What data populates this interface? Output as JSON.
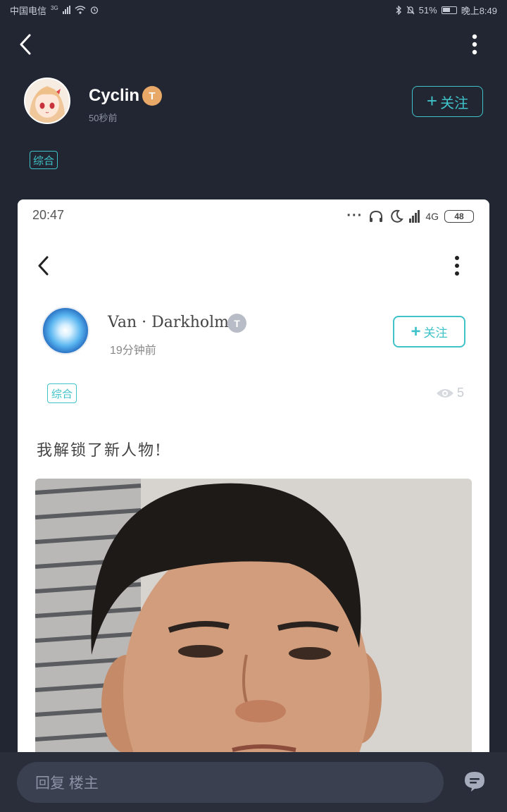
{
  "status_bar": {
    "carrier": "中国电信",
    "network": "3G",
    "battery": "51%",
    "time": "晚上8:49"
  },
  "post": {
    "author": "Cyclin",
    "level": "T",
    "time_ago": "50秒前",
    "follow_label": "关注",
    "tag": "综合"
  },
  "screenshot": {
    "time": "20:47",
    "network": "4G",
    "battery": "48",
    "author": "Van · Darkholme",
    "level": "T",
    "time_ago": "19分钟前",
    "follow_label": "关注",
    "tag": "综合",
    "views": "5",
    "text": "我解锁了新人物!"
  },
  "reply": {
    "placeholder": "回复  楼主"
  },
  "colors": {
    "background": "#222632",
    "accent": "#3fc3c9",
    "level_badge": "#e8a868"
  },
  "icons": [
    "back-arrow-icon",
    "more-vert-icon",
    "plus-icon",
    "eye-icon",
    "comment-icon",
    "bluetooth-icon",
    "wifi-icon",
    "moon-icon",
    "headphones-icon"
  ]
}
